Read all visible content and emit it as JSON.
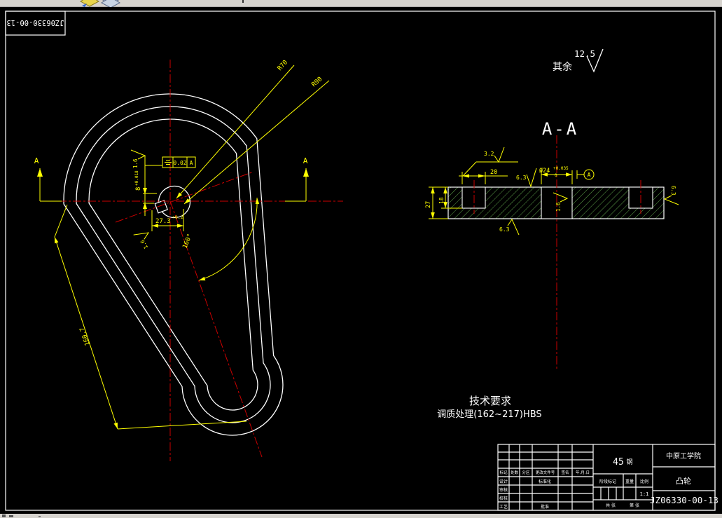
{
  "toolbar": {
    "icon1": "layers-yellow-icon",
    "icon2": "layers-blue-icon"
  },
  "stamp": {
    "number": "JZ06330-00-13"
  },
  "cam": {
    "r70": "R70",
    "r90": "R90",
    "a_left": "A",
    "a_right": "A",
    "kw_w": "8",
    "kw_w_tol": "+0.018",
    "kw_d": "27.3",
    "kw_d_tol": "+0.2",
    "angle": "160°",
    "length": "160.7",
    "rough1": "1.6",
    "rough2": "1.6",
    "fcf_val": "0.02",
    "fcf_datum": "A"
  },
  "section": {
    "title": "A-A",
    "d20": "20",
    "d27": "27",
    "d18": "18",
    "hole": "Ø24",
    "tol_up": "+0.035",
    "tol_low": "0",
    "datum": "A",
    "r32": "3.2",
    "r63a": "6.3",
    "r63b": "6.3",
    "r63c": "6.3",
    "r16": "1.6"
  },
  "general": {
    "label": "其余",
    "value": "12.5"
  },
  "tech": {
    "title": "技术要求",
    "line1": "调质处理(162~217)HBS"
  },
  "tb": {
    "material_num": "45",
    "material_suffix": "钢",
    "org": "中原工学院",
    "part": "凸轮",
    "number": "JZ06330-00-13",
    "scale": "1:1",
    "h_stage": "阶段标记",
    "h_weight": "重量",
    "h_scale": "比例",
    "sheets": "共  张",
    "sheet": "第  张",
    "rev": [
      "标记",
      "处数",
      "分区",
      "更改文件号",
      "签名",
      "年.月.日"
    ],
    "rows": [
      "设计",
      "审核",
      "校核",
      "工艺"
    ],
    "right1": "标准化",
    "right2": "批准"
  },
  "colors": {
    "dim": "#ffff00",
    "line": "#ffffff",
    "center": "#cc0000",
    "hatch": "#5ea34a",
    "chrome": "#d6d3ce"
  }
}
